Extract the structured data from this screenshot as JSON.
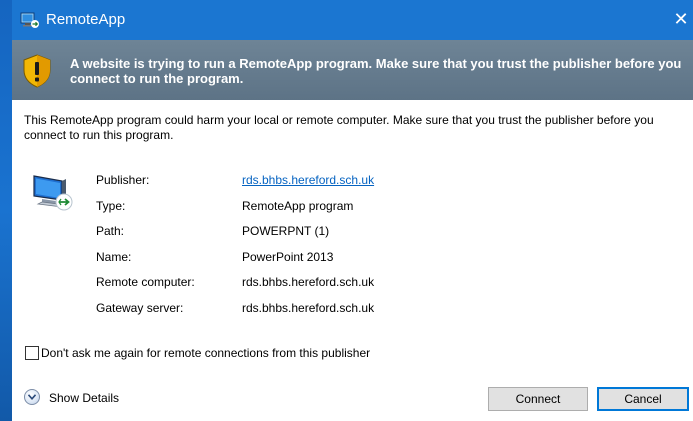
{
  "window": {
    "title": "RemoteApp",
    "close_glyph": "✕"
  },
  "banner": {
    "text": "A website is trying to run a RemoteApp program. Make sure that you trust the publisher before you connect to run the program."
  },
  "intro_text": "This RemoteApp program could harm your local or remote computer. Make sure that you trust the publisher before you connect to run this program.",
  "details": [
    {
      "label": "Publisher:",
      "value": "rds.bhbs.hereford.sch.uk"
    },
    {
      "label": "Type:",
      "value": "RemoteApp program"
    },
    {
      "label": "Path:",
      "value": "POWERPNT (1)"
    },
    {
      "label": "Name:",
      "value": "PowerPoint 2013"
    },
    {
      "label": "Remote computer:",
      "value": "rds.bhbs.hereford.sch.uk"
    },
    {
      "label": "Gateway server:",
      "value": "rds.bhbs.hereford.sch.uk"
    }
  ],
  "checkbox": {
    "label": "Don't ask me again for remote connections from this publisher",
    "checked": false
  },
  "show_details_label": "Show Details",
  "buttons": {
    "connect": "Connect",
    "cancel": "Cancel"
  },
  "colors": {
    "titlebar": "#1b76d1",
    "banner": "#617789",
    "link": "#0563c1",
    "default_button_border": "#0078d7"
  },
  "icons": {
    "app": "remoteapp-icon",
    "banner": "warning-shield-icon",
    "computer": "remote-computer-icon",
    "expand": "chevron-down-icon"
  }
}
